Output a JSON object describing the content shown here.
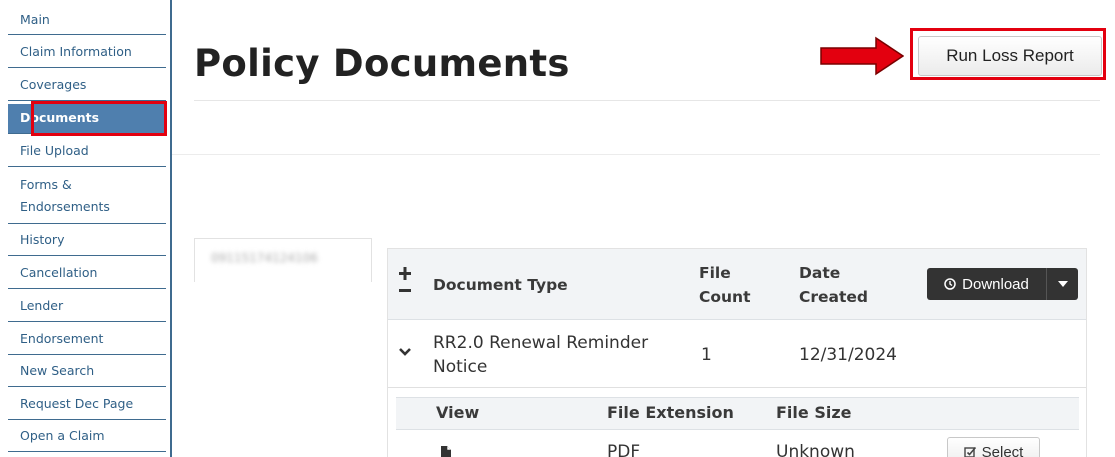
{
  "sidebar": {
    "items": [
      {
        "label": "Main"
      },
      {
        "label": "Claim Information"
      },
      {
        "label": "Coverages"
      },
      {
        "label": "Documents",
        "active": true
      },
      {
        "label": "File Upload"
      },
      {
        "label": "Forms &",
        "label2": "Endorsements"
      },
      {
        "label": "History"
      },
      {
        "label": "Cancellation"
      },
      {
        "label": "Lender"
      },
      {
        "label": "Endorsement"
      },
      {
        "label": "New Search"
      },
      {
        "label": "Request Dec Page"
      },
      {
        "label": "Open a Claim"
      }
    ]
  },
  "page": {
    "title": "Policy Documents",
    "run_loss_report_label": "Run Loss Report"
  },
  "policy_tab": {
    "number": "09115174124106"
  },
  "documents_table": {
    "headers": {
      "document_type": "Document Type",
      "file_count_1": "File",
      "file_count_2": "Count",
      "date_created_1": "Date",
      "date_created_2": "Created"
    },
    "download_label": "Download",
    "rows": [
      {
        "document_type_1": "RR2.0 Renewal Reminder",
        "document_type_2": "Notice",
        "file_count": "1",
        "date_created": "12/31/2024"
      }
    ],
    "files_table": {
      "headers": {
        "view": "View",
        "file_extension": "File Extension",
        "file_size": "File Size"
      },
      "rows": [
        {
          "file_extension": "PDF",
          "file_size": "Unknown",
          "select_label": "Select"
        }
      ]
    }
  },
  "colors": {
    "nav_text": "#2f5f86",
    "nav_active_bg": "#4f7fae",
    "highlight_red": "#e3000f",
    "download_bg": "#333333"
  },
  "icons": {
    "expand": "plus-icon",
    "collapse": "minus-icon",
    "row_toggle": "chevron-down-icon",
    "download": "clock-icon",
    "dropdown": "caret-down-icon",
    "file": "file-icon",
    "select": "checkbox-edit-icon"
  }
}
